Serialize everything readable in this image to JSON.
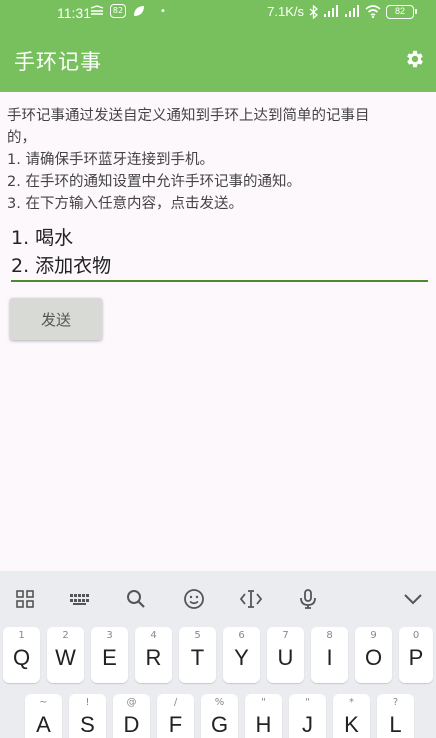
{
  "status_bar": {
    "time": "11:31",
    "notif_badge": "82",
    "dot": "•",
    "net_speed": "7.1K/s",
    "signal1": "HD",
    "signal2": "HD",
    "battery": "82",
    "icons": [
      "mail-icon",
      "leaf-icon",
      "bluetooth-icon",
      "signal-icon",
      "wifi-icon",
      "battery-icon"
    ]
  },
  "app_bar": {
    "title": "手环记事",
    "settings_icon": "gear-icon",
    "color": "#78c05e"
  },
  "description": {
    "lines": [
      "手环记事通过发送自定义通知到手环上达到简单的记事目",
      "的，",
      "1. 请确保手环蓝牙连接到手机。",
      "2. 在手环的通知设置中允许手环记事的通知。",
      "3. 在下方输入任意内容，点击发送。"
    ]
  },
  "note_input": {
    "lines": [
      "1. 喝水",
      "2. 添加衣物"
    ],
    "underline_color": "#4c8a2c"
  },
  "send_button": {
    "label": "发送"
  },
  "keyboard": {
    "tools": [
      "grid-icon",
      "keypad-icon",
      "search-icon",
      "emoji-icon",
      "cursor-icon",
      "mic-icon",
      "collapse-icon"
    ],
    "row1": [
      {
        "main": "Q",
        "hint": "1"
      },
      {
        "main": "W",
        "hint": "2"
      },
      {
        "main": "E",
        "hint": "3"
      },
      {
        "main": "R",
        "hint": "4"
      },
      {
        "main": "T",
        "hint": "5"
      },
      {
        "main": "Y",
        "hint": "6"
      },
      {
        "main": "U",
        "hint": "7"
      },
      {
        "main": "I",
        "hint": "8"
      },
      {
        "main": "O",
        "hint": "9"
      },
      {
        "main": "P",
        "hint": "0"
      }
    ],
    "row2": [
      {
        "main": "A",
        "hint": "~"
      },
      {
        "main": "S",
        "hint": "!"
      },
      {
        "main": "D",
        "hint": "@"
      },
      {
        "main": "F",
        "hint": "/"
      },
      {
        "main": "G",
        "hint": "%"
      },
      {
        "main": "H",
        "hint": "\""
      },
      {
        "main": "J",
        "hint": "\""
      },
      {
        "main": "K",
        "hint": "*"
      },
      {
        "main": "L",
        "hint": "?"
      }
    ]
  }
}
